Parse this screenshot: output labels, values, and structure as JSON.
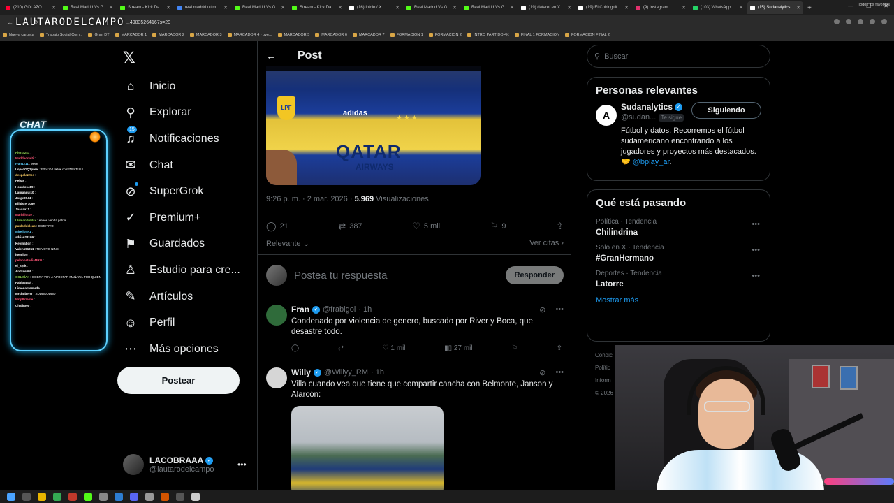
{
  "browser": {
    "tabs": [
      {
        "label": "(210) GOLAZO",
        "active": false,
        "color": "#ff0033"
      },
      {
        "label": "Real Madrid Vs G",
        "active": false,
        "color": "#53fc18"
      },
      {
        "label": "Stream - Kick Da",
        "active": false,
        "color": "#53fc18"
      },
      {
        "label": "real madrid ultim",
        "active": false,
        "color": "#4285f4"
      },
      {
        "label": "Real Madrid Vs G",
        "active": false,
        "color": "#53fc18"
      },
      {
        "label": "Stream - Kick Da",
        "active": false,
        "color": "#53fc18"
      },
      {
        "label": "(16) Inicio / X",
        "active": false,
        "color": "#ffffff"
      },
      {
        "label": "Real Madrid Vs G",
        "active": false,
        "color": "#53fc18"
      },
      {
        "label": "Real Madrid Vs G",
        "active": false,
        "color": "#53fc18"
      },
      {
        "label": "(19) dataref en X",
        "active": false,
        "color": "#ffffff"
      },
      {
        "label": "(19) El Chiringuit",
        "active": false,
        "color": "#ffffff"
      },
      {
        "label": "(9) Instagram",
        "active": false,
        "color": "#e1306c"
      },
      {
        "label": "(103) WhatsApp",
        "active": false,
        "color": "#25d366"
      },
      {
        "label": "(15) Sudanalytics",
        "active": true,
        "color": "#ffffff"
      }
    ],
    "url": "...49835264167s=20",
    "bookmarks": [
      "Nueva carpeta",
      "Trabajo Social Com...",
      "Gran DT",
      "MARCADOR 1",
      "MARCADOR 2",
      "MARCADOR 3",
      "MARCADOR 4 - ove...",
      "MARCADOR 5",
      "MARCADOR 6",
      "MARCADOR 7",
      "FORMACION 1",
      "FORMACION 2",
      "INTRO PARTIDO 4K",
      "FINAL 1 FORMACION",
      "FORMACION FINAL 2"
    ],
    "bookmarks_all": "Todos los favoritos"
  },
  "overlay": {
    "logo_text": "LAUTARODELCAMPO",
    "chat_title": "CHAT",
    "chat_lines": [
      {
        "user": "Pierra241",
        "msg": "",
        "color": "#8fd14f"
      },
      {
        "user": "Maddaonaiti",
        "msg": "",
        "color": "#ff5577"
      },
      {
        "user": "Ivan1211",
        "msg": "eeee",
        "color": "#5cd0ff"
      },
      {
        "user": "LopezGQ2preei",
        "msg": "https://vt.tiktok.com/ZSmTcLL/",
        "color": "#ffffff"
      },
      {
        "user": "despalazitos",
        "msg": "",
        "color": "#ffd166"
      },
      {
        "user": "Febas",
        "msg": "",
        "color": "#ffffff"
      },
      {
        "user": "Hcardo1419",
        "msg": "",
        "color": "#ffffff"
      },
      {
        "user": "Lauraagui10",
        "msg": "",
        "color": "#ffffff"
      },
      {
        "user": "Jorge0944",
        "msg": "",
        "color": "#ffffff"
      },
      {
        "user": "Ellidster1050",
        "msg": "",
        "color": "#ffffff"
      },
      {
        "user": "Joaaaa11",
        "msg": "",
        "color": "#ffffff"
      },
      {
        "user": "Marhiliot19",
        "msg": "",
        "color": "#ff5577"
      },
      {
        "user": "LlamandoMax",
        "msg": "eeeee venda patria",
        "color": "#8fd14f"
      },
      {
        "user": "pauloddeleas",
        "msg": "OBJETIVO",
        "color": "#ffd166"
      },
      {
        "user": "MirellonF1",
        "msg": "",
        "color": "#5cd0ff"
      },
      {
        "user": "adrian23109",
        "msg": "",
        "color": "#ffffff"
      },
      {
        "user": "Kevination",
        "msg": "",
        "color": "#ffffff"
      },
      {
        "user": "Valen191011",
        "msg": "TE VOTO NINE",
        "color": "#ffffff"
      },
      {
        "user": "juenlibrr",
        "msg": "",
        "color": "#ffffff"
      },
      {
        "user": "pelapostodiaMRO",
        "msg": "",
        "color": "#ff5577"
      },
      {
        "user": "el_syrk",
        "msg": "",
        "color": "#ffffff"
      },
      {
        "user": "Andres005",
        "msg": "",
        "color": "#ffffff"
      },
      {
        "user": "COLKlAn",
        "msg": "COBRA VOY A APOSTAR MAÑANA POR QUIEN Y POR QUÉ APUESTO",
        "color": "#8fd14f"
      },
      {
        "user": "Pablo3tabi",
        "msg": "",
        "color": "#ffffff"
      },
      {
        "user": "LimonamsVerde",
        "msg": "",
        "color": "#ffffff"
      },
      {
        "user": "Mrchuberer",
        "msg": "XDDDDDDDD",
        "color": "#ffffff"
      },
      {
        "user": "MrlpBizeme",
        "msg": "",
        "color": "#ff5577"
      },
      {
        "user": "Chalito00",
        "msg": "",
        "color": "#ffffff"
      }
    ]
  },
  "sidebar": {
    "items": [
      {
        "label": "Inicio",
        "icon": "⌂",
        "name": "home"
      },
      {
        "label": "Explorar",
        "icon": "⚲",
        "name": "explore"
      },
      {
        "label": "Notificaciones",
        "icon": "♫",
        "name": "notifications",
        "badge": "15"
      },
      {
        "label": "Chat",
        "icon": "✉",
        "name": "chat"
      },
      {
        "label": "SuperGrok",
        "icon": "⊘",
        "name": "supergrok",
        "dot": true
      },
      {
        "label": "Premium+",
        "icon": "✓",
        "name": "premium"
      },
      {
        "label": "Guardados",
        "icon": "⚑",
        "name": "bookmarks"
      },
      {
        "label": "Estudio para cre...",
        "icon": "♙",
        "name": "studio"
      },
      {
        "label": "Artículos",
        "icon": "✎",
        "name": "articles"
      },
      {
        "label": "Perfil",
        "icon": "☺",
        "name": "profile"
      },
      {
        "label": "Más opciones",
        "icon": "⋯",
        "name": "more"
      }
    ],
    "post_button": "Postear",
    "profile": {
      "name": "LACOBRAAA",
      "handle": "@lautarodelcampo"
    }
  },
  "post": {
    "header_title": "Post",
    "image": {
      "brand": "adidas",
      "text_big": "QATAR",
      "text_small": "AIRWAYS",
      "badge": "LPF"
    },
    "time": "9:26 p. m. · 2 mar. 2026 · ",
    "views_count": "5.969",
    "views_label": " Visualizaciones",
    "stats": {
      "replies": "21",
      "reposts": "387",
      "likes": "5 mil",
      "bookmarks": "9"
    },
    "relevant_label": "Relevante",
    "quotes_label": "Ver citas",
    "reply_placeholder": "Postea tu respuesta",
    "reply_button": "Responder"
  },
  "replies": [
    {
      "name": "Fran",
      "handle": "@frabigol",
      "time": "· 1h",
      "text": "Condenado por violencia de genero, buscado por River y Boca, que desastre todo.",
      "replies": "",
      "reposts": "",
      "likes": "1 mil",
      "views": "27 mil",
      "avatar_color": "#2f6b3a"
    },
    {
      "name": "Willy",
      "handle": "@Willyy_RM",
      "time": "· 1h",
      "text": "Villa cuando vea que tiene que compartir cancha con Belmonte, Janson y Alarcón:",
      "avatar_color": "#d6d6d6"
    }
  ],
  "right": {
    "search_placeholder": "Buscar",
    "relevant_title": "Personas relevantes",
    "relevant_user": {
      "name": "Sudanalytics",
      "handle": "@sudan...",
      "follows_you": "Te sigue",
      "button": "Siguiendo",
      "bio": "Fútbol y datos. Recorremos el fútbol sudamericano encontrando a los jugadores y proyectos más destacados. 🤝 ",
      "bio_link": "@bplay_ar",
      "bio_end": "."
    },
    "trends_title": "Qué está pasando",
    "trends": [
      {
        "meta": "Política · Tendencia",
        "name": "Chilindrina"
      },
      {
        "meta": "Solo en X · Tendencia",
        "name": "#GranHermano"
      },
      {
        "meta": "Deportes · Tendencia",
        "name": "Latorre"
      }
    ],
    "show_more": "Mostrar más",
    "footer": [
      "Condic",
      "Polític",
      "Inform",
      "© 2026"
    ]
  }
}
